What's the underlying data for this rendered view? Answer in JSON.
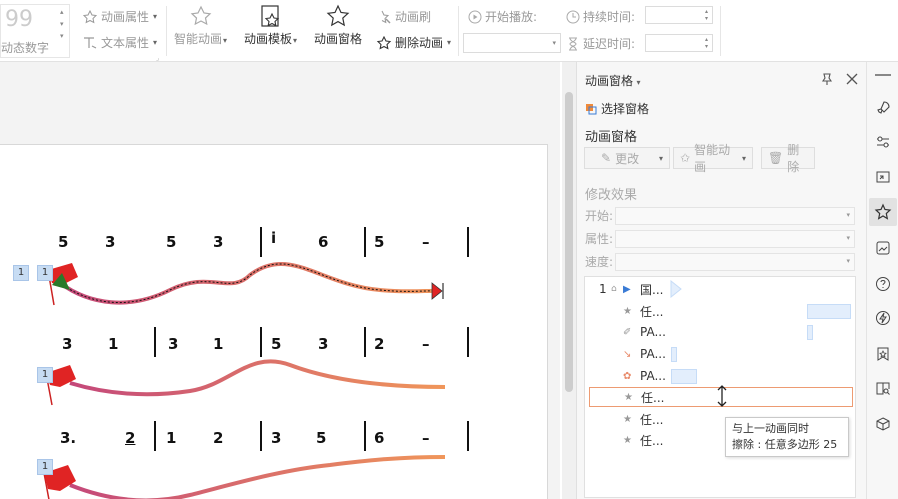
{
  "ribbon": {
    "digit_label": "动态数字",
    "anim_props": "动画属性",
    "text_props": "文本属性",
    "smart_anim": "智能动画",
    "anim_template": "动画模板",
    "anim_pane": "动画窗格",
    "anim_brush": "动画刷",
    "delete_anim": "删除动画",
    "start_play": "开始播放:",
    "duration": "持续时间:",
    "delay": "延迟时间:"
  },
  "score": {
    "row1": [
      "5",
      "3",
      "5",
      "3",
      "i",
      "6",
      "5",
      "–"
    ],
    "row2": [
      "3",
      "1",
      "3",
      "1",
      "5",
      "3",
      "2",
      "–"
    ],
    "row3": [
      "3.",
      "2",
      "1",
      "2",
      "3",
      "5",
      "6",
      "–"
    ],
    "tags": [
      "1",
      "1",
      "1",
      "1"
    ]
  },
  "pane": {
    "title": "动画窗格",
    "select_pane": "选择窗格",
    "section": "动画窗格",
    "change_btn": "更改",
    "smart_btn": "智能动画",
    "delete_btn": "删除",
    "modify_effect": "修改效果",
    "start_label": "开始:",
    "prop_label": "属性:",
    "speed_label": "速度:",
    "items": [
      {
        "num": "1",
        "label": "国..."
      },
      {
        "num": "",
        "label": "任..."
      },
      {
        "num": "",
        "label": "PA..."
      },
      {
        "num": "",
        "label": "PA..."
      },
      {
        "num": "",
        "label": "PA..."
      },
      {
        "num": "",
        "label": "任..."
      },
      {
        "num": "",
        "label": "任..."
      },
      {
        "num": "",
        "label": "任..."
      }
    ],
    "tooltip_line1": "与上一动画同时",
    "tooltip_line2": "擦除 : 任意多边形 25"
  },
  "colors": {
    "accent": "#ed9b72",
    "curve_start": "#c4487a",
    "curve_end": "#f0965a",
    "flag": "#e02424"
  }
}
